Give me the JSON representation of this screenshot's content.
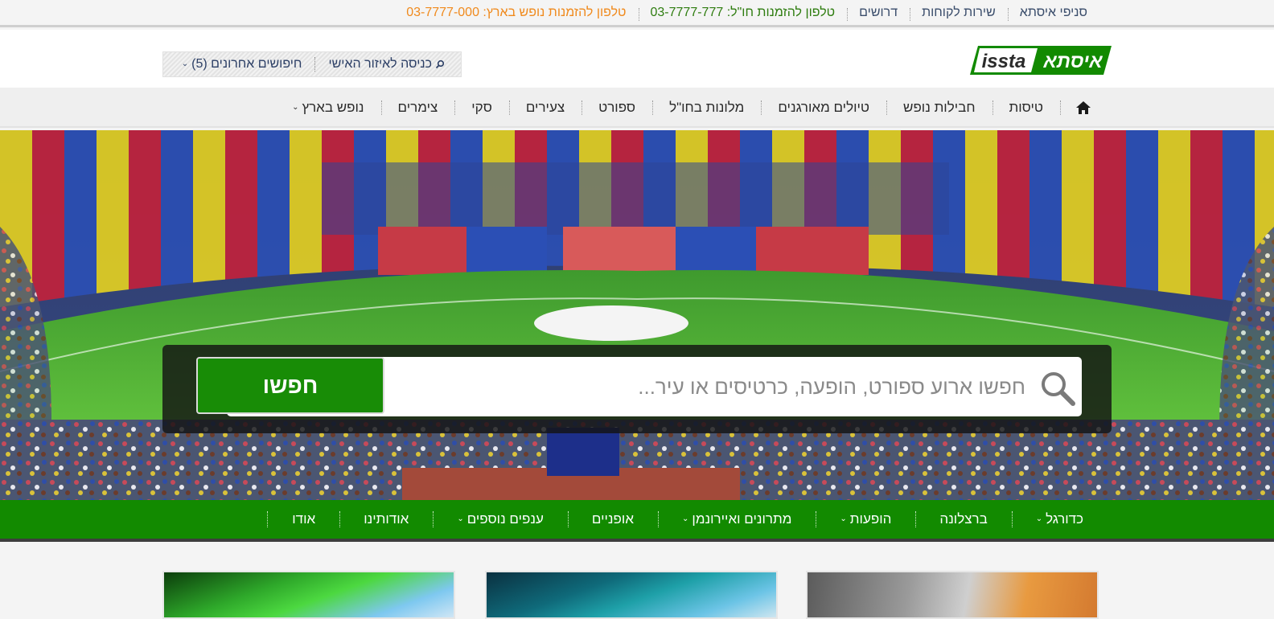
{
  "topbar": {
    "links": [
      {
        "id": "branches",
        "label": "סניפי איסתא",
        "color": "#3a4d6b"
      },
      {
        "id": "customer-service",
        "label": "שירות לקוחות",
        "color": "#3a4d6b"
      },
      {
        "id": "jobs",
        "label": "דרושים",
        "color": "#3a4d6b"
      },
      {
        "id": "abroad-phone",
        "label": "טלפון להזמנות חו\"ל: 03-7777-777",
        "color": "#2f7d10"
      },
      {
        "id": "local-phone",
        "label": "טלפון להזמנות נופש בארץ: 03-7777-000",
        "color": "#f08a1d"
      }
    ]
  },
  "header": {
    "logo_text_he": "איסתא",
    "logo_text_en": "issta",
    "personal_area_label": "כניסה לאיזור האישי",
    "recent_searches_label": "חיפושים אחרונים (5)"
  },
  "mainnav": {
    "items": [
      {
        "id": "flights",
        "label": "טיסות"
      },
      {
        "id": "packages",
        "label": "חבילות נופש"
      },
      {
        "id": "organized",
        "label": "טיולים מאורגנים"
      },
      {
        "id": "hotels",
        "label": "מלונות בחו\"ל"
      },
      {
        "id": "sport",
        "label": "ספורט"
      },
      {
        "id": "youth",
        "label": "צעירים"
      },
      {
        "id": "ski",
        "label": "סקי"
      },
      {
        "id": "cabins",
        "label": "צימרים"
      },
      {
        "id": "local",
        "label": "נופש בארץ",
        "dropdown": true
      }
    ]
  },
  "search": {
    "placeholder": "חפשו ארוע ספורט, הופעה, כרטיסים או עיר...",
    "button_label": "חפשו"
  },
  "subnav": {
    "items": [
      {
        "id": "football",
        "label": "כדורגל",
        "dropdown": true
      },
      {
        "id": "barcelona",
        "label": "ברצלונה"
      },
      {
        "id": "shows",
        "label": "הופעות",
        "dropdown": true
      },
      {
        "id": "marathons",
        "label": "מתרונים ואיירונמן",
        "dropdown": true
      },
      {
        "id": "bikes",
        "label": "אופניים"
      },
      {
        "id": "more",
        "label": "ענפים נוספים",
        "dropdown": true
      },
      {
        "id": "about-us",
        "label": "אודותינו"
      },
      {
        "id": "about",
        "label": "אודו"
      }
    ]
  },
  "colors": {
    "brand_green": "#128a00",
    "search_button": "#188c06",
    "phone_green": "#2f7d10",
    "phone_orange": "#f08a1d"
  }
}
